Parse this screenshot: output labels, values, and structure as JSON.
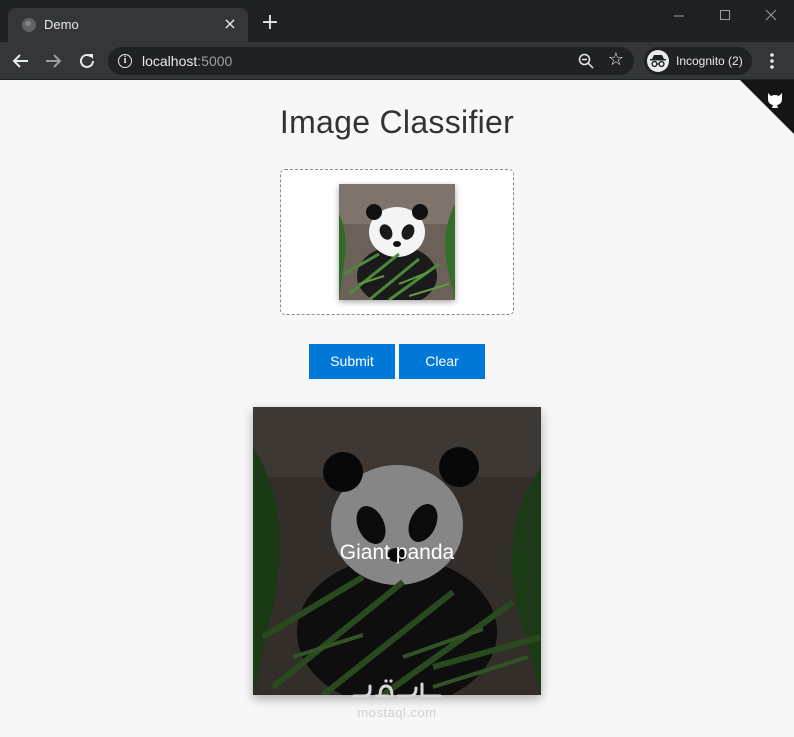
{
  "browser": {
    "tab_title": "Demo",
    "tab_close_icon": "close-icon",
    "new_tab_icon": "plus-icon",
    "url_host": "localhost",
    "url_port": ":5000",
    "incognito_label": "Incognito (2)"
  },
  "page": {
    "title": "Image Classifier",
    "submit_label": "Submit",
    "clear_label": "Clear",
    "prediction": "Giant panda",
    "accent_color": "#0078d7",
    "corner_icon": "github-octocat-icon",
    "preview_image": "giant-panda-photo"
  },
  "watermark": {
    "text": "mostaql.com",
    "logo_text": "مستقل"
  }
}
